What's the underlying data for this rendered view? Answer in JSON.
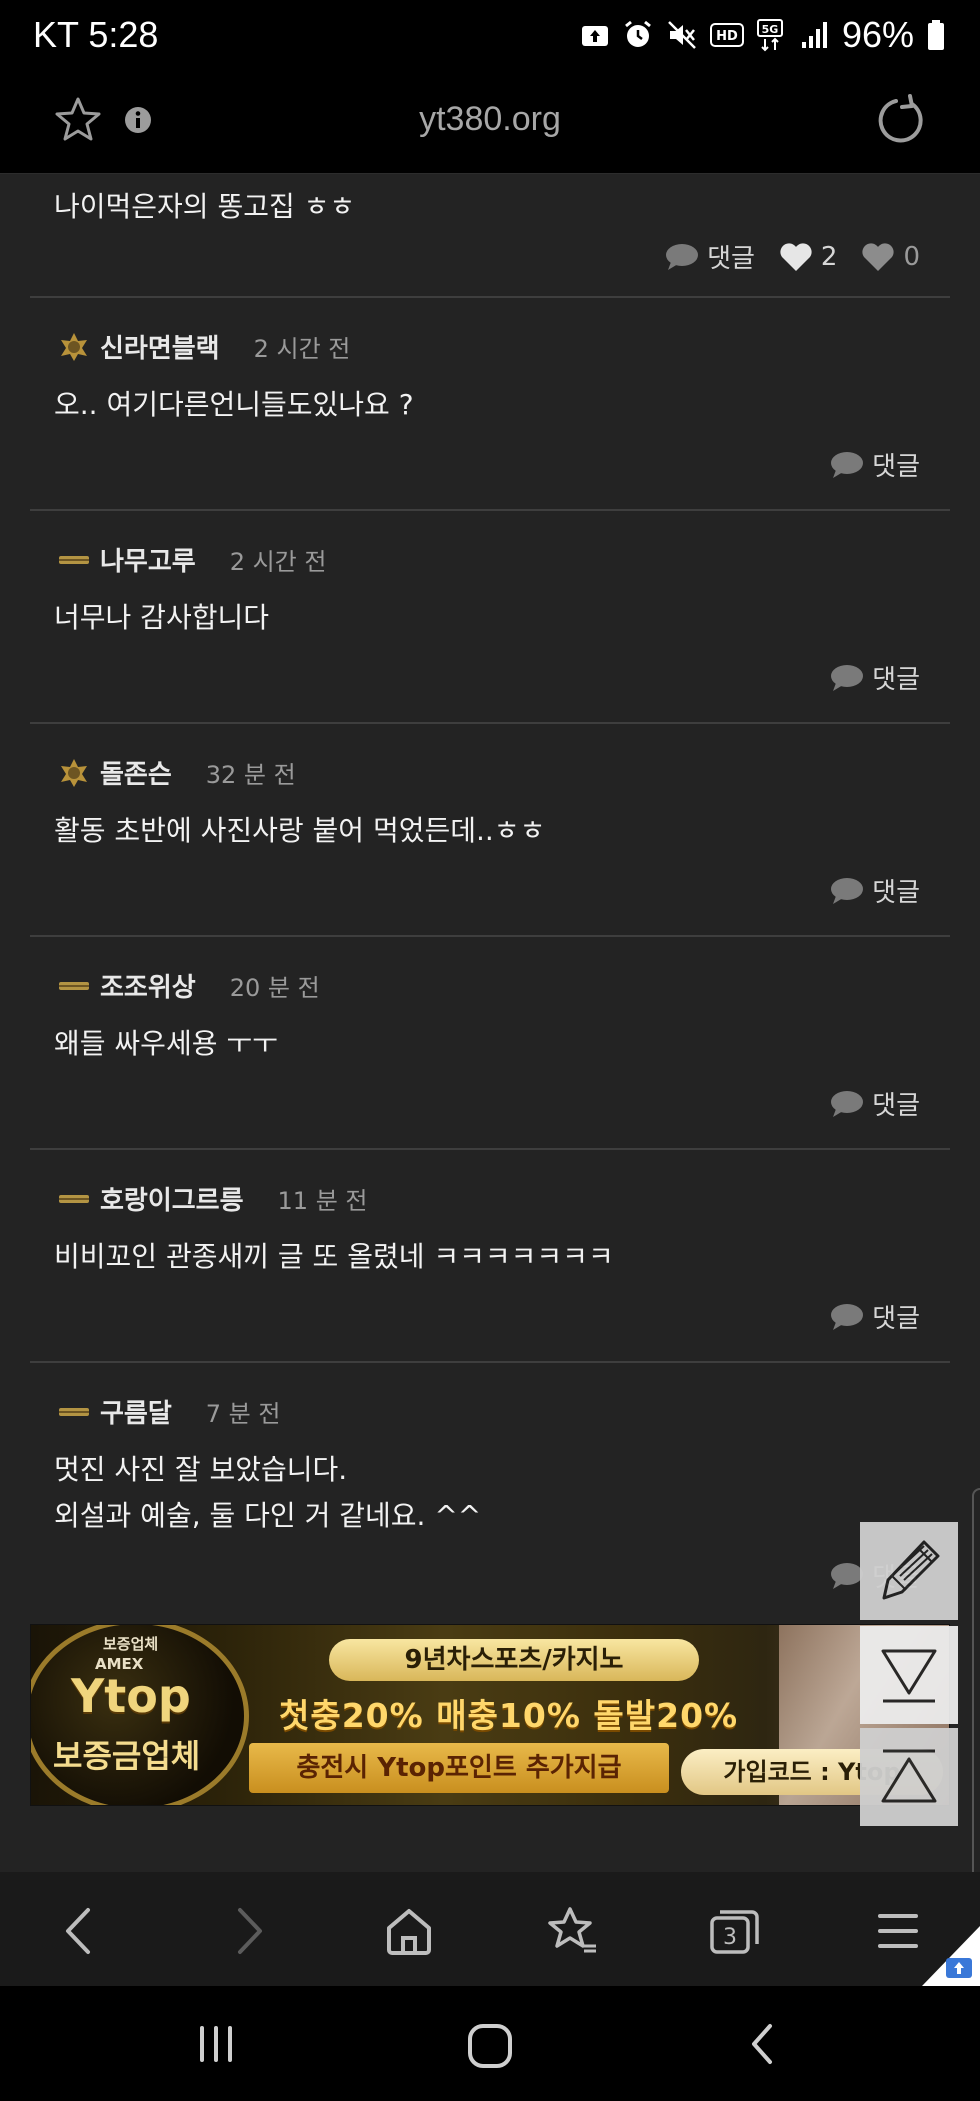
{
  "status_bar": {
    "carrier_time": "KT 5:28",
    "network": "5G",
    "battery": "96%"
  },
  "browser": {
    "url": "yt380.org"
  },
  "top_partial": {
    "text": "나이먹은자의 똥고집 ㅎㅎ",
    "reply_label": "댓글",
    "likes": "2",
    "dislikes": "0"
  },
  "comments": [
    {
      "name": "신라면블랙",
      "time": "2 시간 전",
      "lines": [
        "오.. 여기다른언니들도있나요 ?"
      ],
      "reply_label": "댓글",
      "badge": "gold-badge"
    },
    {
      "name": "나무고루",
      "time": "2 시간 전",
      "lines": [
        "너무나 감사합니다"
      ],
      "reply_label": "댓글",
      "badge": "bar-badge"
    },
    {
      "name": "돌존슨",
      "time": "32 분 전",
      "lines": [
        "활동 초반에 사진사랑 붙어 먹었든데..ㅎㅎ"
      ],
      "reply_label": "댓글",
      "badge": "gold-badge"
    },
    {
      "name": "조조위상",
      "time": "20 분 전",
      "lines": [
        "왜들 싸우세용 ㅜㅜ"
      ],
      "reply_label": "댓글",
      "badge": "bar-badge"
    },
    {
      "name": "호랑이그르릉",
      "time": "11 분 전",
      "lines": [
        "비비꼬인 관종새끼 글 또 올렸네 ㅋㅋㅋㅋㅋㅋㅋ"
      ],
      "reply_label": "댓글",
      "badge": "bar-badge"
    },
    {
      "name": "구름달",
      "time": "7 분 전",
      "lines": [
        "멋진 사진 잘 보았습니다.",
        "외설과 예술, 둘 다인 거 같네요. ^^"
      ],
      "reply_label": "댓글",
      "badge": "bar-badge"
    }
  ],
  "banner": {
    "small1": "보증업체",
    "small2": "AMEX",
    "logo": "Ytop",
    "sub": "보증금업체",
    "headline": "9년차스포츠/카지노",
    "bonus": "첫충20% 매충10% 돌발20%",
    "points": "충전시 Ytop포인트 추가지급",
    "code": "가입코드 : Ytop"
  },
  "bottom_nav": {
    "tabs_count": "3"
  },
  "colors": {
    "background": "#232323",
    "text": "#f2f2f2",
    "muted": "#9a9a9a",
    "divider": "#3e3e3e"
  }
}
